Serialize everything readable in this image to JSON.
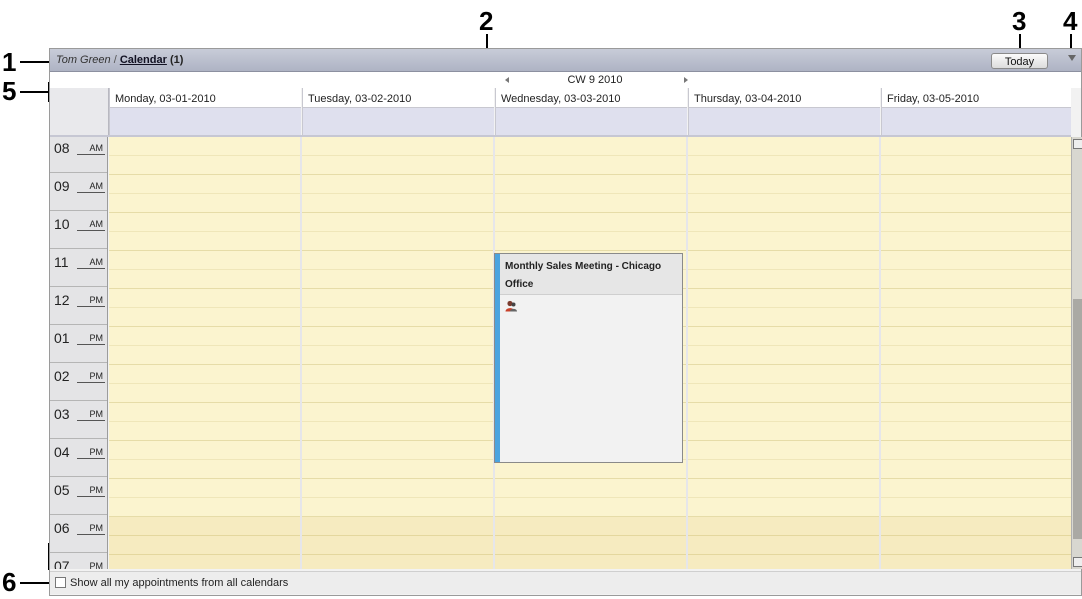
{
  "callouts": [
    "1",
    "2",
    "3",
    "4",
    "5",
    "6"
  ],
  "titlebar": {
    "user": "Tom Green",
    "separator": "/",
    "calendar": "Calendar",
    "count": "(1)"
  },
  "toolbar": {
    "today_label": "Today"
  },
  "week": {
    "label": "CW 9 2010"
  },
  "days": [
    "Monday, 03-01-2010",
    "Tuesday, 03-02-2010",
    "Wednesday, 03-03-2010",
    "Thursday, 03-04-2010",
    "Friday, 03-05-2010"
  ],
  "hours": [
    {
      "h": "08",
      "ap": "AM"
    },
    {
      "h": "09",
      "ap": "AM"
    },
    {
      "h": "10",
      "ap": "AM"
    },
    {
      "h": "11",
      "ap": "AM"
    },
    {
      "h": "12",
      "ap": "PM"
    },
    {
      "h": "01",
      "ap": "PM"
    },
    {
      "h": "02",
      "ap": "PM"
    },
    {
      "h": "03",
      "ap": "PM"
    },
    {
      "h": "04",
      "ap": "PM"
    },
    {
      "h": "05",
      "ap": "PM"
    },
    {
      "h": "06",
      "ap": "PM"
    },
    {
      "h": "07",
      "ap": "PM"
    }
  ],
  "appointment": {
    "title": "Monthly Sales Meeting - Chicago Office",
    "icon": "participants-icon",
    "color": "#4ba4df"
  },
  "footer": {
    "show_all_label": "Show all my appointments from all calendars"
  }
}
